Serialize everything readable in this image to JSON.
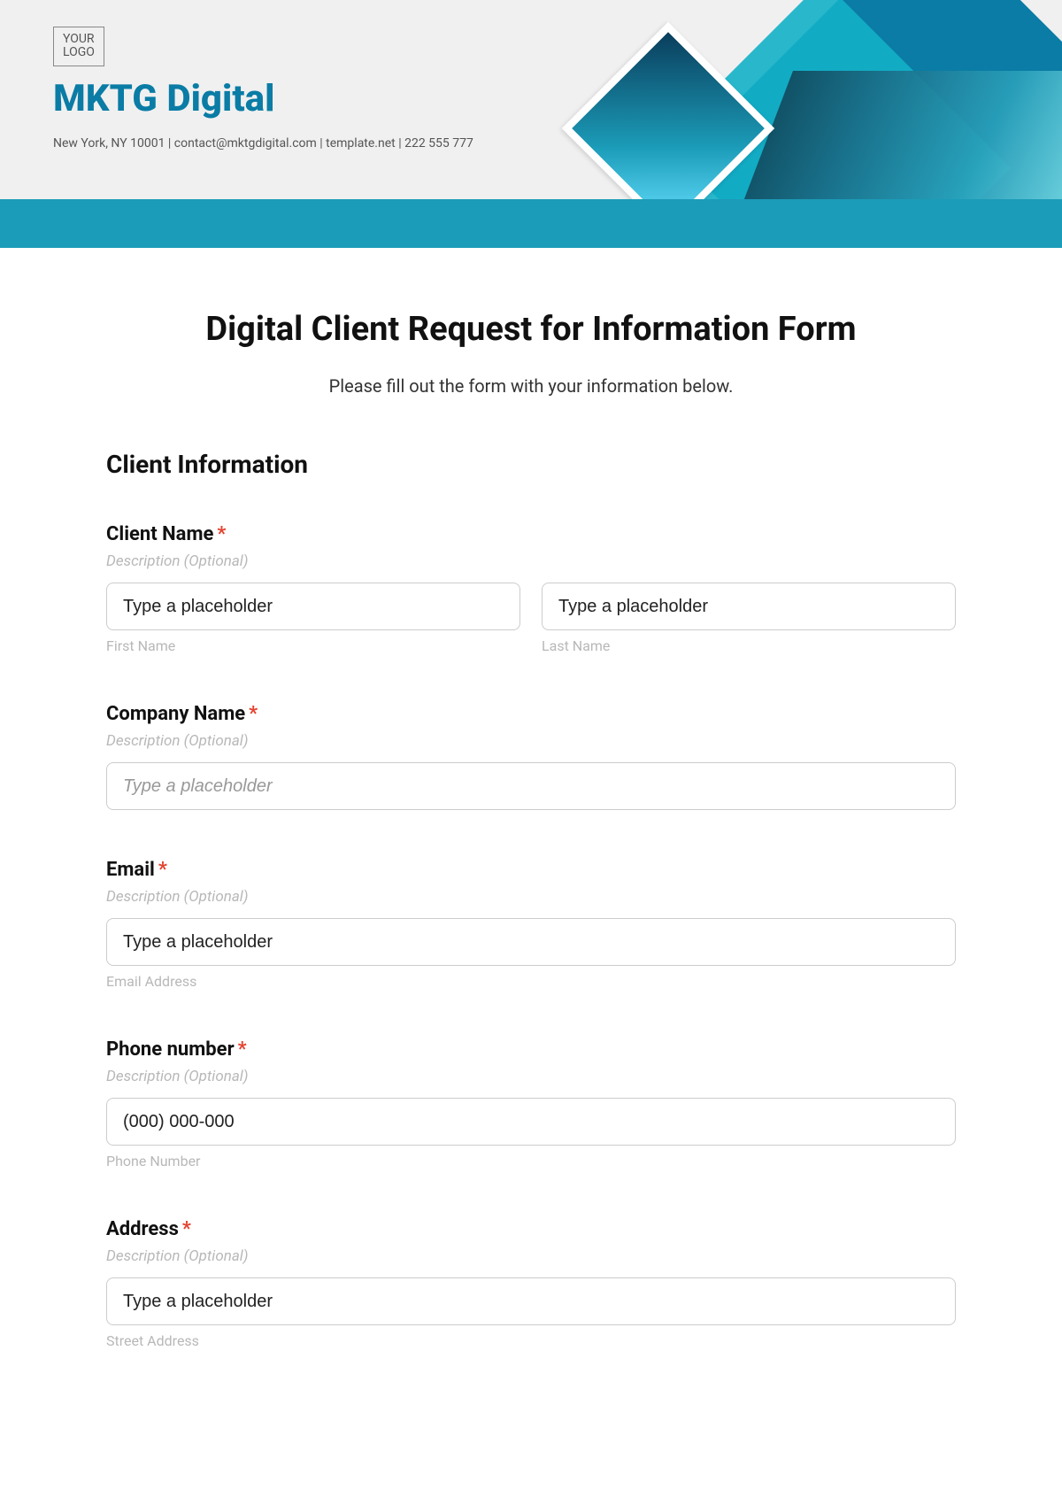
{
  "header": {
    "logo_text": "YOUR\nLOGO",
    "company_name": "MKTG Digital",
    "contact_line": "New York, NY 10001 | contact@mktgdigital.com | template.net | 222 555 777"
  },
  "form": {
    "title": "Digital Client Request for Information Form",
    "subtitle": "Please fill out the form with your information below.",
    "section_header": "Client Information",
    "required_marker": "*",
    "fields": {
      "client_name": {
        "label": "Client Name",
        "desc": "Description (Optional)",
        "first_placeholder": "Type a placeholder",
        "first_sublabel": "First Name",
        "last_placeholder": "Type a placeholder",
        "last_sublabel": "Last Name"
      },
      "company_name": {
        "label": "Company Name",
        "desc": "Description (Optional)",
        "placeholder": "Type a placeholder"
      },
      "email": {
        "label": "Email",
        "desc": "Description (Optional)",
        "placeholder": "Type a placeholder",
        "sublabel": "Email Address"
      },
      "phone": {
        "label": "Phone number",
        "desc": "Description (Optional)",
        "placeholder": "(000) 000-000",
        "sublabel": "Phone Number"
      },
      "address": {
        "label": "Address",
        "desc": "Description (Optional)",
        "placeholder": "Type a placeholder",
        "sublabel": "Street Address"
      }
    }
  }
}
